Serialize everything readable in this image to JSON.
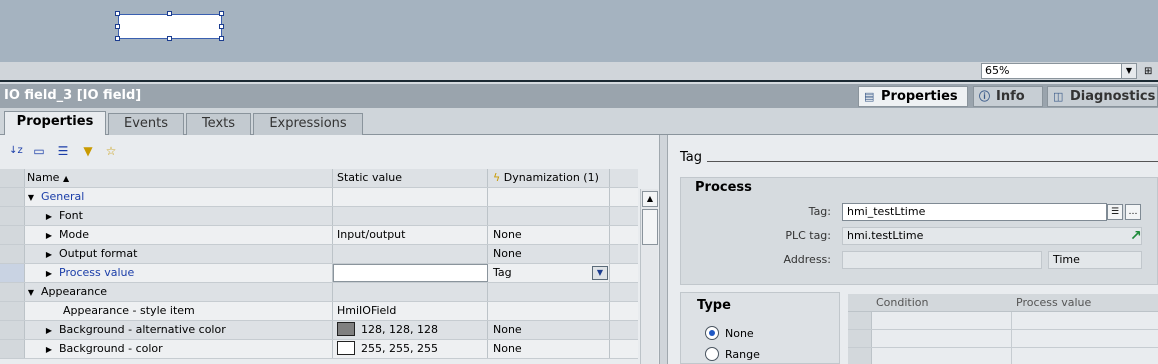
{
  "canvas": {
    "zoom": "65%"
  },
  "inspector": {
    "title": "IO field_3 [IO field]",
    "tabs": [
      {
        "label": "Properties",
        "icon": "properties-icon"
      },
      {
        "label": "Info",
        "icon": "info-icon"
      },
      {
        "label": "Diagnostics",
        "icon": "diagnostics-icon"
      }
    ]
  },
  "subtabs": [
    "Properties",
    "Events",
    "Texts",
    "Expressions"
  ],
  "grid": {
    "headers": {
      "name": "Name",
      "static": "Static value",
      "dyn": "Dynamization (1)"
    },
    "rows": [
      {
        "name": "General",
        "static": "",
        "dyn": ""
      },
      {
        "name": "Font",
        "static": "",
        "dyn": ""
      },
      {
        "name": "Mode",
        "static": "Input/output",
        "dyn": "None"
      },
      {
        "name": "Output format",
        "static": "",
        "dyn": "None"
      },
      {
        "name": "Process value",
        "static": "",
        "dyn": "Tag"
      },
      {
        "name": "Appearance",
        "static": "",
        "dyn": ""
      },
      {
        "name": "Appearance - style item",
        "static": "HmiIOField",
        "dyn": ""
      },
      {
        "name": "Background - alternative color",
        "static": "128, 128, 128",
        "dyn": "None"
      },
      {
        "name": "Background - color",
        "static": "255, 255, 255",
        "dyn": "None"
      }
    ],
    "colors": {
      "bg_alt": "#808080",
      "bg": "#ffffff"
    }
  },
  "tag_panel": {
    "section": "Tag",
    "process": {
      "heading": "Process",
      "tag_label": "Tag:",
      "tag_value": "hmi_testLtime",
      "plc_label": "PLC tag:",
      "plc_value": "hmi.testLtime",
      "address_label": "Address:",
      "address_value": "",
      "type_value": "Time"
    },
    "type": {
      "heading": "Type",
      "options": [
        "None",
        "Range"
      ],
      "selected": "None"
    },
    "conditions": {
      "col_condition": "Condition",
      "col_process": "Process value"
    }
  }
}
